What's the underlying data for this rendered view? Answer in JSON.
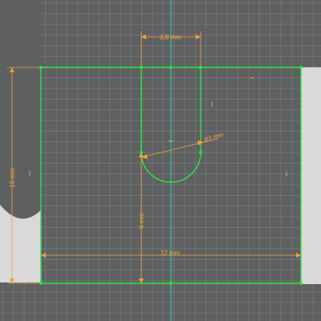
{
  "sketch": {
    "dimensions": {
      "top_width_label": "2,8 mm",
      "hole_diameter_label": "ø3 mm",
      "left_height_label": "10 mm",
      "slot_height_label": "6 mm",
      "bottom_width_label": "12 mm"
    },
    "colors": {
      "background": "#5f6062",
      "solid_fill": "#d9d9d9",
      "sketch_line": "#29e63a",
      "axis": "#2ed0a8",
      "dimension": "#f0a23a"
    }
  }
}
